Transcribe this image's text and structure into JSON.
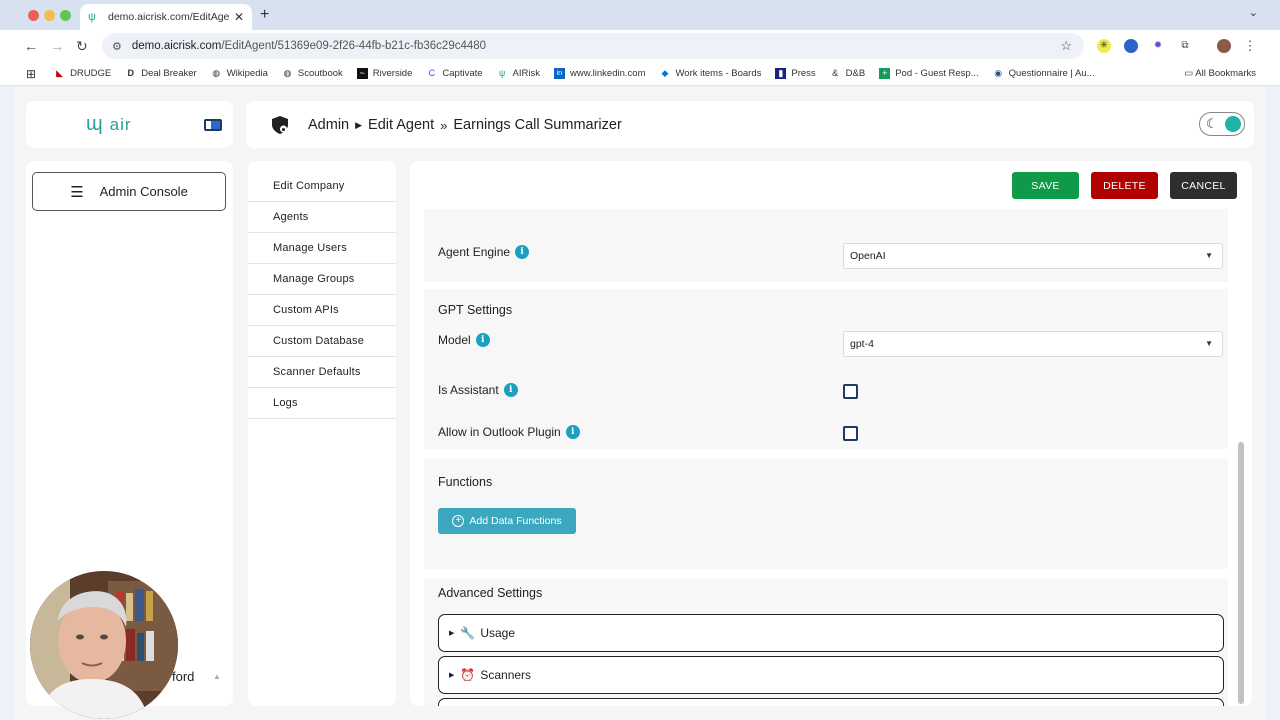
{
  "browser": {
    "tab_title": "demo.aicrisk.com/EditAgent/",
    "tab_close": "✕",
    "new_tab": "+",
    "url_host": "demo.aicrisk.com",
    "url_path": "/EditAgent/51369e09-2f26-44fb-b21c-fb36c29c4480",
    "bookmarks": [
      "DRUDGE",
      "Deal Breaker",
      "Wikipedia",
      "Scoutbook",
      "Riverside",
      "Captivate",
      "AIRisk",
      "www.linkedin.com",
      "Work items - Boards",
      "Press",
      "D&B",
      "Pod - Guest Resp...",
      "Questionnaire | Au..."
    ],
    "all_bookmarks": "All Bookmarks"
  },
  "app": {
    "logo_mark": "ɰ",
    "logo_text": "air",
    "breadcrumb": {
      "root": "Admin",
      "sep1": "▶",
      "section": "Edit Agent",
      "sep2": "»",
      "page": "Earnings Call Summarizer"
    },
    "console_label": "Admin Console",
    "user_name": "ford"
  },
  "admin_menu": [
    "Edit Company",
    "Agents",
    "Manage Users",
    "Manage Groups",
    "Custom APIs",
    "Custom Database",
    "Scanner Defaults",
    "Logs"
  ],
  "actions": {
    "save": "SAVE",
    "delete": "DELETE",
    "cancel": "CANCEL"
  },
  "form": {
    "agent_engine_label": "Agent Engine",
    "agent_engine_value": "OpenAI",
    "gpt_settings_heading": "GPT Settings",
    "model_label": "Model",
    "model_value": "gpt-4",
    "is_assistant_label": "Is Assistant",
    "is_assistant_checked": false,
    "allow_outlook_label": "Allow in Outlook Plugin",
    "allow_outlook_checked": false,
    "functions_heading": "Functions",
    "add_functions_label": "Add Data Functions",
    "advanced_heading": "Advanced Settings",
    "accordions": [
      "Usage",
      "Scanners"
    ]
  },
  "colors": {
    "save": "#0e9a48",
    "delete": "#b00000",
    "cancel": "#2e2e2e",
    "accent": "#3ba8c0",
    "info": "#1e9fc0"
  }
}
